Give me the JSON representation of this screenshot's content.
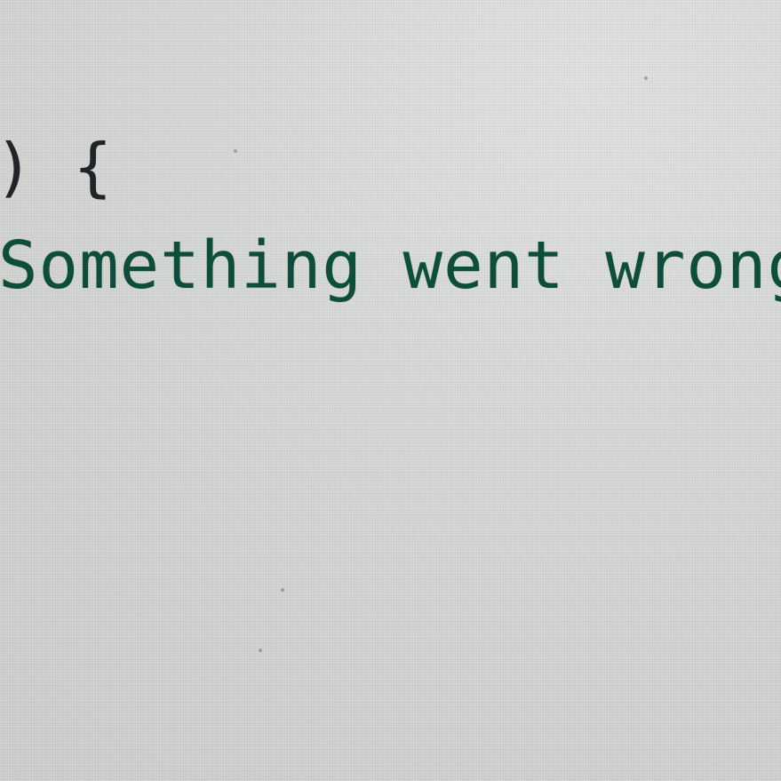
{
  "code_lines": [
    {
      "text": ") {"
    },
    {
      "text": "Something went wrong"
    },
    {
      "text": ";"
    }
  ],
  "colors": {
    "background": "#d7d9d6",
    "code_text": "#202328",
    "string_text": "#0d4e3a"
  }
}
